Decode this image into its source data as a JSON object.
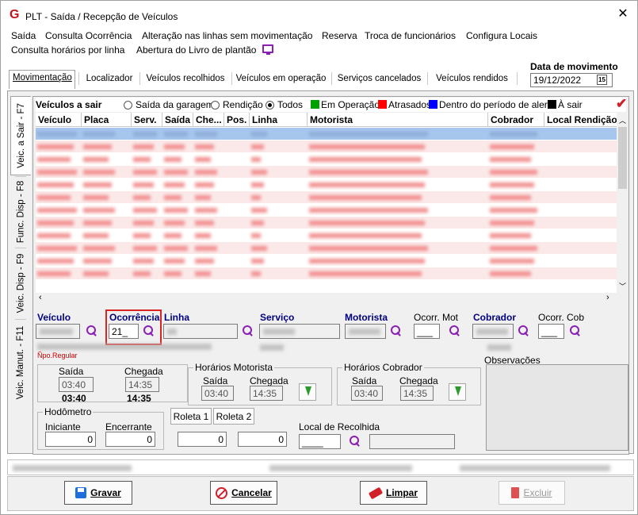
{
  "window": {
    "title": "PLT - Saída / Recepção de Veículos",
    "close_glyph": "✕",
    "logo_letter": "G"
  },
  "menu": {
    "row1": [
      "Saída",
      "Consulta Ocorrência",
      "Alteração nas linhas sem movimentação",
      "Reserva",
      "Troca de funcionários",
      "Configura Locais"
    ],
    "row2": [
      "Consulta horários por linha",
      "Abertura do Livro de plantão"
    ],
    "monitor_icon": "monitor-icon"
  },
  "tabs": [
    "Movimentação",
    "Localizador",
    "Veículos recolhidos",
    "Veículos em operação",
    "Serviços cancelados",
    "Veículos rendidos"
  ],
  "date": {
    "label": "Data de movimento",
    "value": "19/12/2022",
    "cal_glyph": "15"
  },
  "side_tabs": [
    "Veic. a Sair - F7",
    "Func. Disp - F8",
    "Veic. Disp - F9",
    "Veic. Manut. - F11"
  ],
  "filter": {
    "title": "Veículos a sair",
    "options": [
      "Saída da garagem",
      "Rendição",
      "Todos"
    ],
    "selected": "Todos",
    "legend": [
      {
        "label": "Em Operação",
        "color": "#00a000"
      },
      {
        "label": "Atrasados",
        "color": "#ff0000"
      },
      {
        "label": "Dentro do período de alerta",
        "color": "#0000ff"
      },
      {
        "label": "À sair",
        "color": "#000000"
      }
    ]
  },
  "grid": {
    "columns": [
      "Veículo",
      "Placa",
      "Serv.",
      "Saída",
      "Che...",
      "Pos.",
      "Linha",
      "Motorista",
      "Cobrador",
      "Local Rendição"
    ]
  },
  "fields": {
    "veiculo_label": "Veículo",
    "ocorrencia_label": "Ocorrência",
    "ocorrencia_value": "21_",
    "linha_label": "Linha",
    "servico_label": "Serviço",
    "motorista_label": "Motorista",
    "ocorr_mot_label": "Ocorr. Mot",
    "ocorr_mot_value": "___",
    "cobrador_label": "Cobrador",
    "ocorr_cob_label": "Ocorr. Cob",
    "ocorr_cob_value": "___",
    "irregular": "Ñpo.Regular"
  },
  "times": {
    "saida_label": "Saída",
    "chegada_label": "Chegada",
    "saida": "03:40",
    "chegada": "14:35",
    "saida_bold": "03:40",
    "chegada_bold": "14:35"
  },
  "horarios_motorista": {
    "title": "Horários Motorista",
    "saida_label": "Saída",
    "chegada_label": "Chegada",
    "saida": "03:40",
    "chegada": "14:35"
  },
  "horarios_cobrador": {
    "title": "Horários Cobrador",
    "saida_label": "Saída",
    "chegada_label": "Chegada",
    "saida": "03:40",
    "chegada": "14:35"
  },
  "observacoes": "Observações",
  "hodometro": {
    "title": "Hodômetro",
    "iniciante_label": "Iniciante",
    "encerrante_label": "Encerrante",
    "iniciante": "0",
    "encerrante": "0"
  },
  "roleta": {
    "tab1": "Roleta 1",
    "tab2": "Roleta 2",
    "v1": "0",
    "v2": "0"
  },
  "local_recolhida": {
    "label": "Local de Recolhida",
    "value": "____"
  },
  "buttons": {
    "gravar": "Gravar",
    "cancelar": "Cancelar",
    "limpar": "Limpar",
    "excluir": "Excluir"
  }
}
